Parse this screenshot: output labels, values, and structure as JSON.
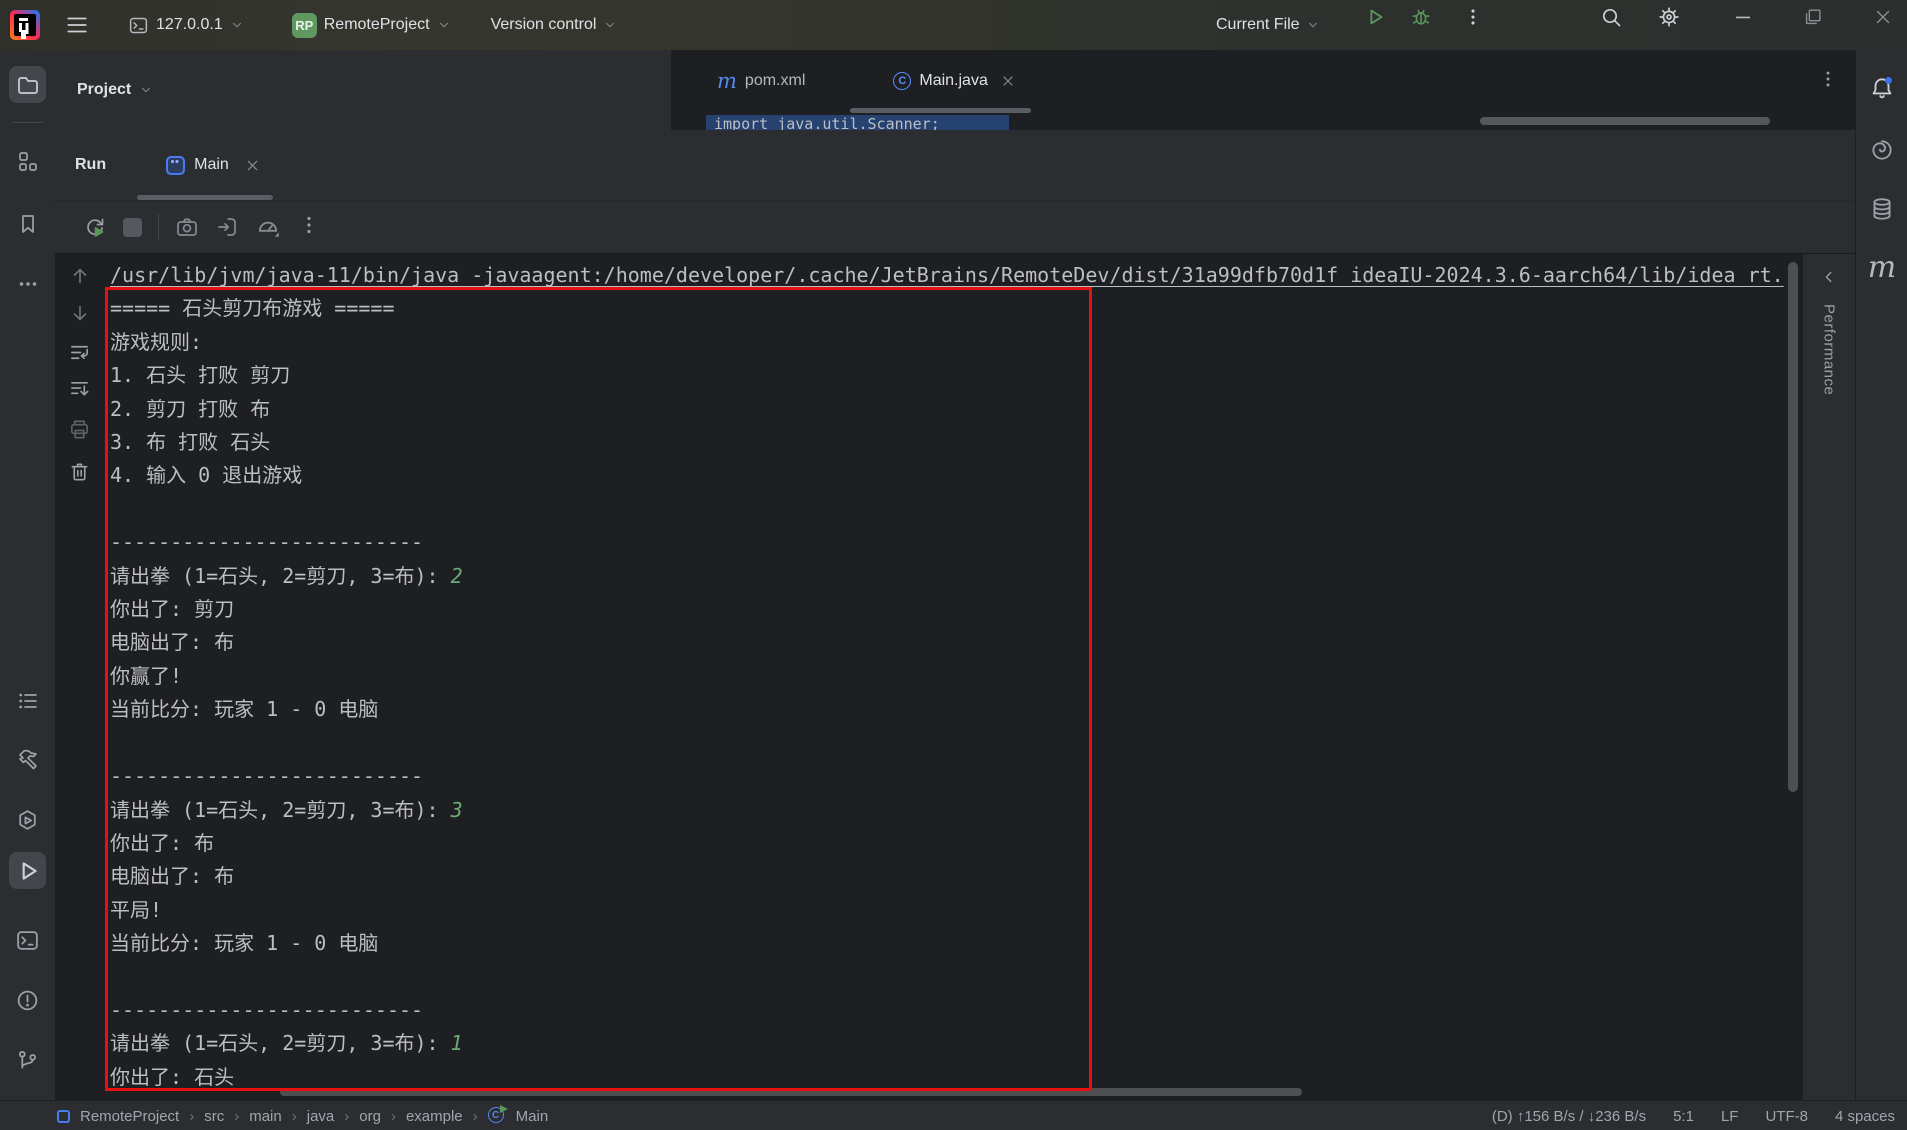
{
  "colors": {
    "accent_blue": "#3574f0",
    "run_green": "#57965c",
    "input_green": "#6aab73",
    "annotation_red": "#e81111",
    "badge_green": "#5f9961",
    "notification_blue": "#3574f0"
  },
  "icons": {
    "maven_glyph": "m",
    "class_glyph": "C",
    "breadcrumb_separator": "›"
  },
  "titlebar": {
    "host": "127.0.0.1",
    "project_badge": "RP",
    "project_name": "RemoteProject",
    "vcs_label": "Version control",
    "run_config": "Current File"
  },
  "project_panel": {
    "title": "Project"
  },
  "editor": {
    "tabs": [
      {
        "label": "pom.xml"
      },
      {
        "label": "Main.java"
      }
    ],
    "sliver_code": "import java.util.Scanner;"
  },
  "run_panel": {
    "title": "Run",
    "tab_label": "Main",
    "console_lines": [
      {
        "kind": "cmd",
        "text": "/usr/lib/jvm/java-11/bin/java -javaagent:/home/developer/.cache/JetBrains/RemoteDev/dist/31a99dfb70d1f_ideaIU-2024.3.6-aarch64/lib/idea_rt."
      },
      {
        "kind": "out",
        "text": "===== 石头剪刀布游戏 ====="
      },
      {
        "kind": "out",
        "text": "游戏规则:"
      },
      {
        "kind": "out",
        "text": "1. 石头 打败 剪刀"
      },
      {
        "kind": "out",
        "text": "2. 剪刀 打败 布"
      },
      {
        "kind": "out",
        "text": "3. 布 打败 石头"
      },
      {
        "kind": "out",
        "text": "4. 输入 0 退出游戏"
      },
      {
        "kind": "blank",
        "text": ""
      },
      {
        "kind": "out",
        "text": "--------------------------"
      },
      {
        "kind": "prompt",
        "text": "请出拳 (1=石头, 2=剪刀, 3=布): ",
        "input": "2"
      },
      {
        "kind": "out",
        "text": "你出了: 剪刀"
      },
      {
        "kind": "out",
        "text": "电脑出了: 布"
      },
      {
        "kind": "out",
        "text": "你赢了!"
      },
      {
        "kind": "out",
        "text": "当前比分: 玩家 1 - 0 电脑"
      },
      {
        "kind": "blank",
        "text": ""
      },
      {
        "kind": "out",
        "text": "--------------------------"
      },
      {
        "kind": "prompt",
        "text": "请出拳 (1=石头, 2=剪刀, 3=布): ",
        "input": "3"
      },
      {
        "kind": "out",
        "text": "你出了: 布"
      },
      {
        "kind": "out",
        "text": "电脑出了: 布"
      },
      {
        "kind": "out",
        "text": "平局!"
      },
      {
        "kind": "out",
        "text": "当前比分: 玩家 1 - 0 电脑"
      },
      {
        "kind": "blank",
        "text": ""
      },
      {
        "kind": "out",
        "text": "--------------------------"
      },
      {
        "kind": "prompt",
        "text": "请出拳 (1=石头, 2=剪刀, 3=布): ",
        "input": "1"
      },
      {
        "kind": "out",
        "text": "你出了: 石头"
      }
    ]
  },
  "right_stripe": {
    "performance_label": "Performance"
  },
  "statusbar": {
    "breadcrumbs": [
      {
        "label": "RemoteProject",
        "icon": "project"
      },
      {
        "label": "src"
      },
      {
        "label": "main"
      },
      {
        "label": "java"
      },
      {
        "label": "org"
      },
      {
        "label": "example"
      },
      {
        "label": "Main",
        "icon": "class"
      }
    ],
    "right": [
      "(D) ↑156 B/s / ↓236 B/s",
      "5:1",
      "LF",
      "UTF-8",
      "4 spaces"
    ]
  }
}
